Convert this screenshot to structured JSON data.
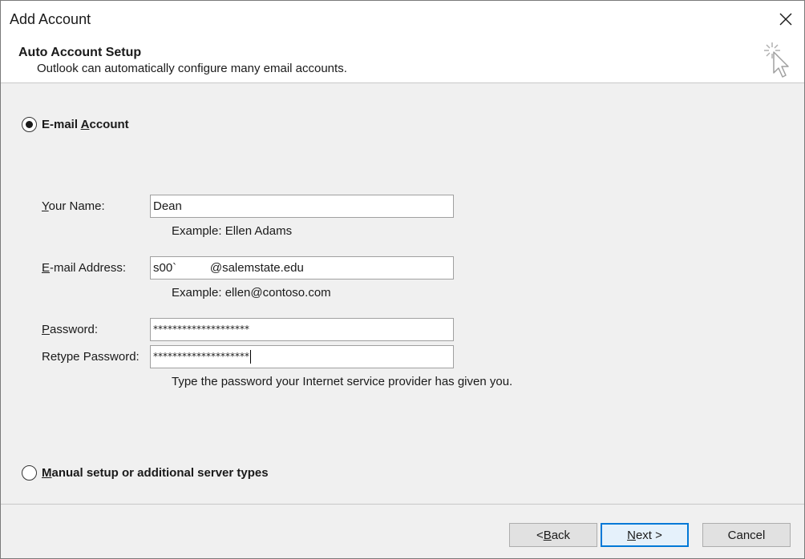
{
  "window": {
    "title": "Add Account"
  },
  "header": {
    "title": "Auto Account Setup",
    "subtitle": "Outlook can automatically configure many email accounts."
  },
  "options": {
    "email_account": {
      "pre": "E-mail ",
      "mnemonic": "A",
      "post": "ccount",
      "selected": true
    },
    "manual_setup": {
      "pre": "",
      "mnemonic": "M",
      "post": "anual setup or additional server types",
      "selected": false
    }
  },
  "form": {
    "name": {
      "label_mnemonic": "Y",
      "label_rest": "our Name:",
      "value": "Dean",
      "hint": "Example: Ellen Adams"
    },
    "email": {
      "label_mnemonic": "E",
      "label_rest": "-mail Address:",
      "value": "s00`          @salemstate.edu",
      "hint": "Example: ellen@contoso.com"
    },
    "password": {
      "label_mnemonic": "P",
      "label_rest": "assword:",
      "value": "********************"
    },
    "retype_password": {
      "label": "Retype Password:",
      "value": "********************"
    },
    "password_hint": "Type the password your Internet service provider has given you."
  },
  "buttons": {
    "back": {
      "pre": "< ",
      "mnemonic": "B",
      "post": "ack"
    },
    "next": {
      "pre": "",
      "mnemonic": "N",
      "post": "ext >"
    },
    "cancel": {
      "label": "Cancel"
    }
  },
  "colors": {
    "accent": "#0078d7",
    "dialog_bg": "#f0f0f0",
    "header_bg": "#ffffff"
  },
  "icons": {
    "close": "close-icon",
    "wizard": "sparkle-cursor-icon"
  }
}
